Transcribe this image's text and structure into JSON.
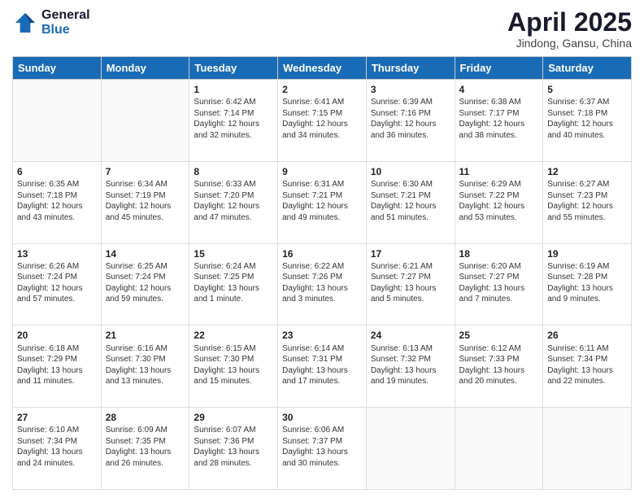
{
  "header": {
    "logo_line1": "General",
    "logo_line2": "Blue",
    "month_title": "April 2025",
    "location": "Jindong, Gansu, China"
  },
  "weekdays": [
    "Sunday",
    "Monday",
    "Tuesday",
    "Wednesday",
    "Thursday",
    "Friday",
    "Saturday"
  ],
  "weeks": [
    [
      {
        "day": "",
        "info": ""
      },
      {
        "day": "",
        "info": ""
      },
      {
        "day": "1",
        "info": "Sunrise: 6:42 AM\nSunset: 7:14 PM\nDaylight: 12 hours\nand 32 minutes."
      },
      {
        "day": "2",
        "info": "Sunrise: 6:41 AM\nSunset: 7:15 PM\nDaylight: 12 hours\nand 34 minutes."
      },
      {
        "day": "3",
        "info": "Sunrise: 6:39 AM\nSunset: 7:16 PM\nDaylight: 12 hours\nand 36 minutes."
      },
      {
        "day": "4",
        "info": "Sunrise: 6:38 AM\nSunset: 7:17 PM\nDaylight: 12 hours\nand 38 minutes."
      },
      {
        "day": "5",
        "info": "Sunrise: 6:37 AM\nSunset: 7:18 PM\nDaylight: 12 hours\nand 40 minutes."
      }
    ],
    [
      {
        "day": "6",
        "info": "Sunrise: 6:35 AM\nSunset: 7:18 PM\nDaylight: 12 hours\nand 43 minutes."
      },
      {
        "day": "7",
        "info": "Sunrise: 6:34 AM\nSunset: 7:19 PM\nDaylight: 12 hours\nand 45 minutes."
      },
      {
        "day": "8",
        "info": "Sunrise: 6:33 AM\nSunset: 7:20 PM\nDaylight: 12 hours\nand 47 minutes."
      },
      {
        "day": "9",
        "info": "Sunrise: 6:31 AM\nSunset: 7:21 PM\nDaylight: 12 hours\nand 49 minutes."
      },
      {
        "day": "10",
        "info": "Sunrise: 6:30 AM\nSunset: 7:21 PM\nDaylight: 12 hours\nand 51 minutes."
      },
      {
        "day": "11",
        "info": "Sunrise: 6:29 AM\nSunset: 7:22 PM\nDaylight: 12 hours\nand 53 minutes."
      },
      {
        "day": "12",
        "info": "Sunrise: 6:27 AM\nSunset: 7:23 PM\nDaylight: 12 hours\nand 55 minutes."
      }
    ],
    [
      {
        "day": "13",
        "info": "Sunrise: 6:26 AM\nSunset: 7:24 PM\nDaylight: 12 hours\nand 57 minutes."
      },
      {
        "day": "14",
        "info": "Sunrise: 6:25 AM\nSunset: 7:24 PM\nDaylight: 12 hours\nand 59 minutes."
      },
      {
        "day": "15",
        "info": "Sunrise: 6:24 AM\nSunset: 7:25 PM\nDaylight: 13 hours\nand 1 minute."
      },
      {
        "day": "16",
        "info": "Sunrise: 6:22 AM\nSunset: 7:26 PM\nDaylight: 13 hours\nand 3 minutes."
      },
      {
        "day": "17",
        "info": "Sunrise: 6:21 AM\nSunset: 7:27 PM\nDaylight: 13 hours\nand 5 minutes."
      },
      {
        "day": "18",
        "info": "Sunrise: 6:20 AM\nSunset: 7:27 PM\nDaylight: 13 hours\nand 7 minutes."
      },
      {
        "day": "19",
        "info": "Sunrise: 6:19 AM\nSunset: 7:28 PM\nDaylight: 13 hours\nand 9 minutes."
      }
    ],
    [
      {
        "day": "20",
        "info": "Sunrise: 6:18 AM\nSunset: 7:29 PM\nDaylight: 13 hours\nand 11 minutes."
      },
      {
        "day": "21",
        "info": "Sunrise: 6:16 AM\nSunset: 7:30 PM\nDaylight: 13 hours\nand 13 minutes."
      },
      {
        "day": "22",
        "info": "Sunrise: 6:15 AM\nSunset: 7:30 PM\nDaylight: 13 hours\nand 15 minutes."
      },
      {
        "day": "23",
        "info": "Sunrise: 6:14 AM\nSunset: 7:31 PM\nDaylight: 13 hours\nand 17 minutes."
      },
      {
        "day": "24",
        "info": "Sunrise: 6:13 AM\nSunset: 7:32 PM\nDaylight: 13 hours\nand 19 minutes."
      },
      {
        "day": "25",
        "info": "Sunrise: 6:12 AM\nSunset: 7:33 PM\nDaylight: 13 hours\nand 20 minutes."
      },
      {
        "day": "26",
        "info": "Sunrise: 6:11 AM\nSunset: 7:34 PM\nDaylight: 13 hours\nand 22 minutes."
      }
    ],
    [
      {
        "day": "27",
        "info": "Sunrise: 6:10 AM\nSunset: 7:34 PM\nDaylight: 13 hours\nand 24 minutes."
      },
      {
        "day": "28",
        "info": "Sunrise: 6:09 AM\nSunset: 7:35 PM\nDaylight: 13 hours\nand 26 minutes."
      },
      {
        "day": "29",
        "info": "Sunrise: 6:07 AM\nSunset: 7:36 PM\nDaylight: 13 hours\nand 28 minutes."
      },
      {
        "day": "30",
        "info": "Sunrise: 6:06 AM\nSunset: 7:37 PM\nDaylight: 13 hours\nand 30 minutes."
      },
      {
        "day": "",
        "info": ""
      },
      {
        "day": "",
        "info": ""
      },
      {
        "day": "",
        "info": ""
      }
    ]
  ]
}
